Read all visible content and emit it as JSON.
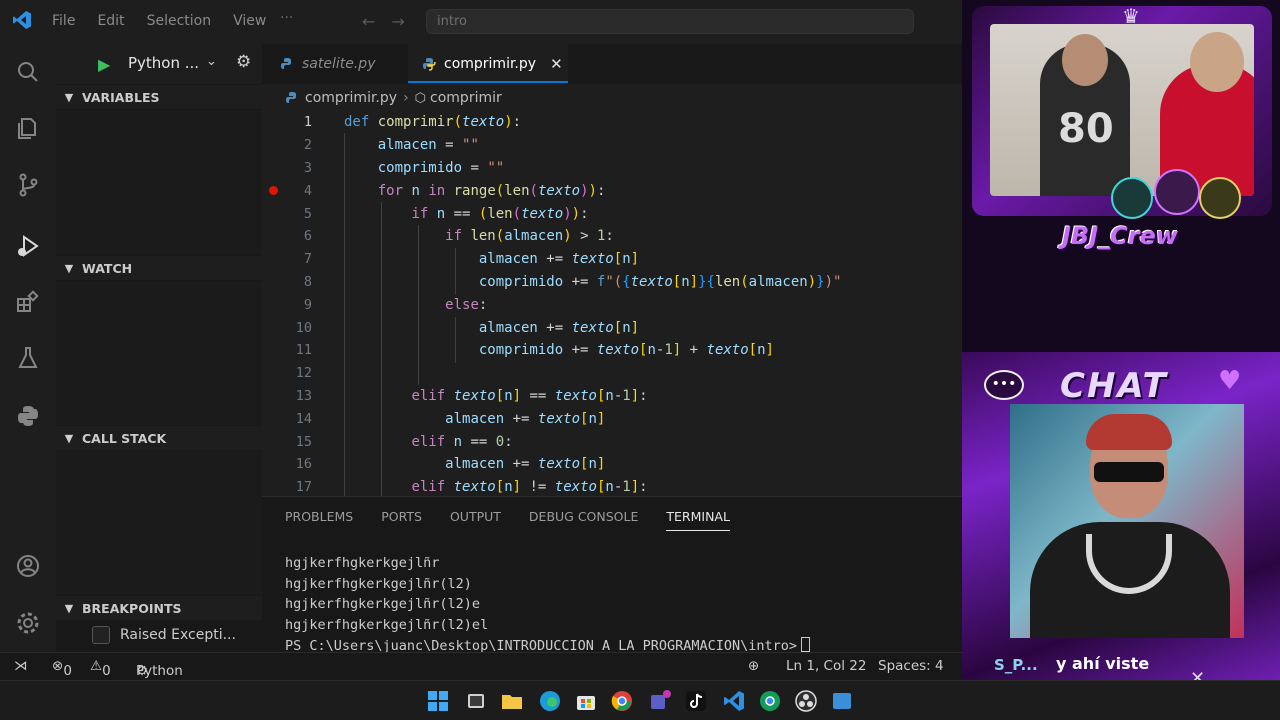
{
  "window": {
    "menu": [
      "File",
      "Edit",
      "Selection",
      "View"
    ],
    "more": "···",
    "search_placeholder": "intro"
  },
  "run": {
    "config_label": "Python ..."
  },
  "sidebar": {
    "variables": "VARIABLES",
    "watch": "WATCH",
    "call_stack": "CALL STACK",
    "breakpoints": "BREAKPOINTS",
    "breakpoint_items": [
      "Raised Excepti..."
    ]
  },
  "tabs": [
    {
      "label": "satelite.py",
      "active": false
    },
    {
      "label": "comprimir.py",
      "active": true
    }
  ],
  "breadcrumb": {
    "file": "comprimir.py",
    "symbol": "comprimir"
  },
  "code": {
    "current_line": 1,
    "breakpoint_lines": [
      4
    ],
    "line_numbers": [
      "1",
      "2",
      "3",
      "4",
      "5",
      "6",
      "7",
      "8",
      "9",
      "10",
      "11",
      "12",
      "13",
      "14",
      "15",
      "16",
      "17"
    ]
  },
  "panel": {
    "tabs": [
      "PROBLEMS",
      "PORTS",
      "OUTPUT",
      "DEBUG CONSOLE",
      "TERMINAL"
    ],
    "active_tab": "TERMINAL",
    "terminal_lines": [
      "hgjkerfhgkerkgejlñr",
      "hgjkerfhgkerkgejlñr(l2)",
      "hgjkerfhgkerkgejlñr(l2)e",
      "hgjkerfhgkerkgejlñr(l2)el"
    ],
    "prompt": "PS C:\\Users\\juanc\\Desktop\\INTRODUCCION A LA PROGRAMACION\\intro>"
  },
  "status": {
    "errors": "0",
    "warnings": "0",
    "debugger": "Python Debugger: Python File (intro)",
    "position": "Ln 1, Col 22",
    "spaces": "Spaces: 4"
  },
  "overlay": {
    "jersey_number": "80",
    "crew_name": "JBJ_Crew",
    "chat_title": "CHAT",
    "chat_user": "S_P...",
    "chat_message": "y ahí viste"
  },
  "colors": {
    "accent": "#0078d4",
    "breakpoint": "#e51400",
    "run_green": "#3fbf5f"
  }
}
